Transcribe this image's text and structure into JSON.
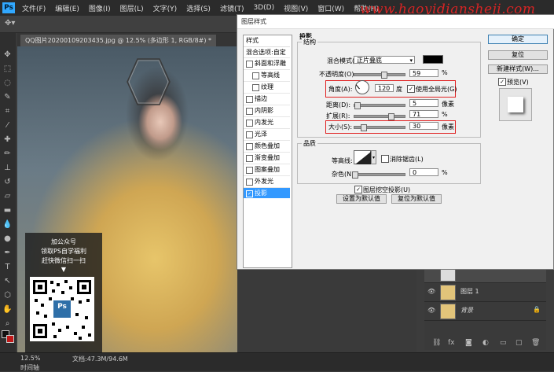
{
  "menubar": {
    "logo": "Ps",
    "items": [
      "文件(F)",
      "编辑(E)",
      "图像(I)",
      "图层(L)",
      "文字(Y)",
      "选择(S)",
      "滤镜(T)",
      "3D(D)",
      "视图(V)",
      "窗口(W)",
      "帮助(H)"
    ],
    "watermark": "www.haoyidiansheji.com"
  },
  "tab": {
    "title": "QQ图片20200109203435.jpg @ 12.5% (多边形 1, RGB/8#) *"
  },
  "promo": {
    "line1": "加公众号",
    "line2": "领取PS自学福利",
    "line3": "赶快微信扫一扫",
    "arrow": "▼",
    "ps_badge": "Ps"
  },
  "statusbar": {
    "zoom": "12.5%",
    "doc": "文档:47.3M/94.6M",
    "timeline": "时间轴"
  },
  "layers": [
    {
      "name": "图层 1"
    },
    {
      "name": "背景",
      "lock": "🔒"
    }
  ],
  "dialog": {
    "title": "图层样式",
    "styles_header": "样式",
    "blend_options": "混合选项:自定",
    "style_items": [
      {
        "label": "斜面和浮雕",
        "checked": false,
        "sub": false
      },
      {
        "label": "等高线",
        "checked": false,
        "sub": true
      },
      {
        "label": "纹理",
        "checked": false,
        "sub": true
      },
      {
        "label": "描边",
        "checked": false,
        "sub": false
      },
      {
        "label": "内阴影",
        "checked": false,
        "sub": false
      },
      {
        "label": "内发光",
        "checked": false,
        "sub": false
      },
      {
        "label": "光泽",
        "checked": false,
        "sub": false
      },
      {
        "label": "颜色叠加",
        "checked": false,
        "sub": false
      },
      {
        "label": "渐变叠加",
        "checked": false,
        "sub": false
      },
      {
        "label": "图案叠加",
        "checked": false,
        "sub": false
      },
      {
        "label": "外发光",
        "checked": false,
        "sub": false
      },
      {
        "label": "投影",
        "checked": true,
        "sub": false,
        "selected": true
      }
    ],
    "section_title": "投影",
    "structure_title": "结构",
    "blend_mode_label": "混合模式(B):",
    "blend_mode_value": "正片叠底",
    "opacity_label": "不透明度(O):",
    "opacity_value": "59",
    "percent": "%",
    "angle_label": "角度(A):",
    "angle_value": "120",
    "degree": "度",
    "global_light_label": "使用全局光(G)",
    "distance_label": "距离(D):",
    "distance_value": "5",
    "spread_label": "扩展(R):",
    "spread_value": "71",
    "size_label": "大小(S):",
    "size_value": "30",
    "px": "像素",
    "quality_title": "品质",
    "contour_label": "等高线:",
    "antialias_label": "消除锯齿(L)",
    "noise_label": "杂色(N):",
    "noise_value": "0",
    "knockout_label": "图层挖空投影(U)",
    "default_btn": "设置为默认值",
    "reset_default_btn": "复位为默认值",
    "ok": "确定",
    "reset": "复位",
    "new_style": "新建样式(W)...",
    "preview": "预览(V)"
  },
  "colors": {
    "accent_red": "#e02020",
    "selection_blue": "#3399ff",
    "ps_blue": "#31a8ff"
  }
}
